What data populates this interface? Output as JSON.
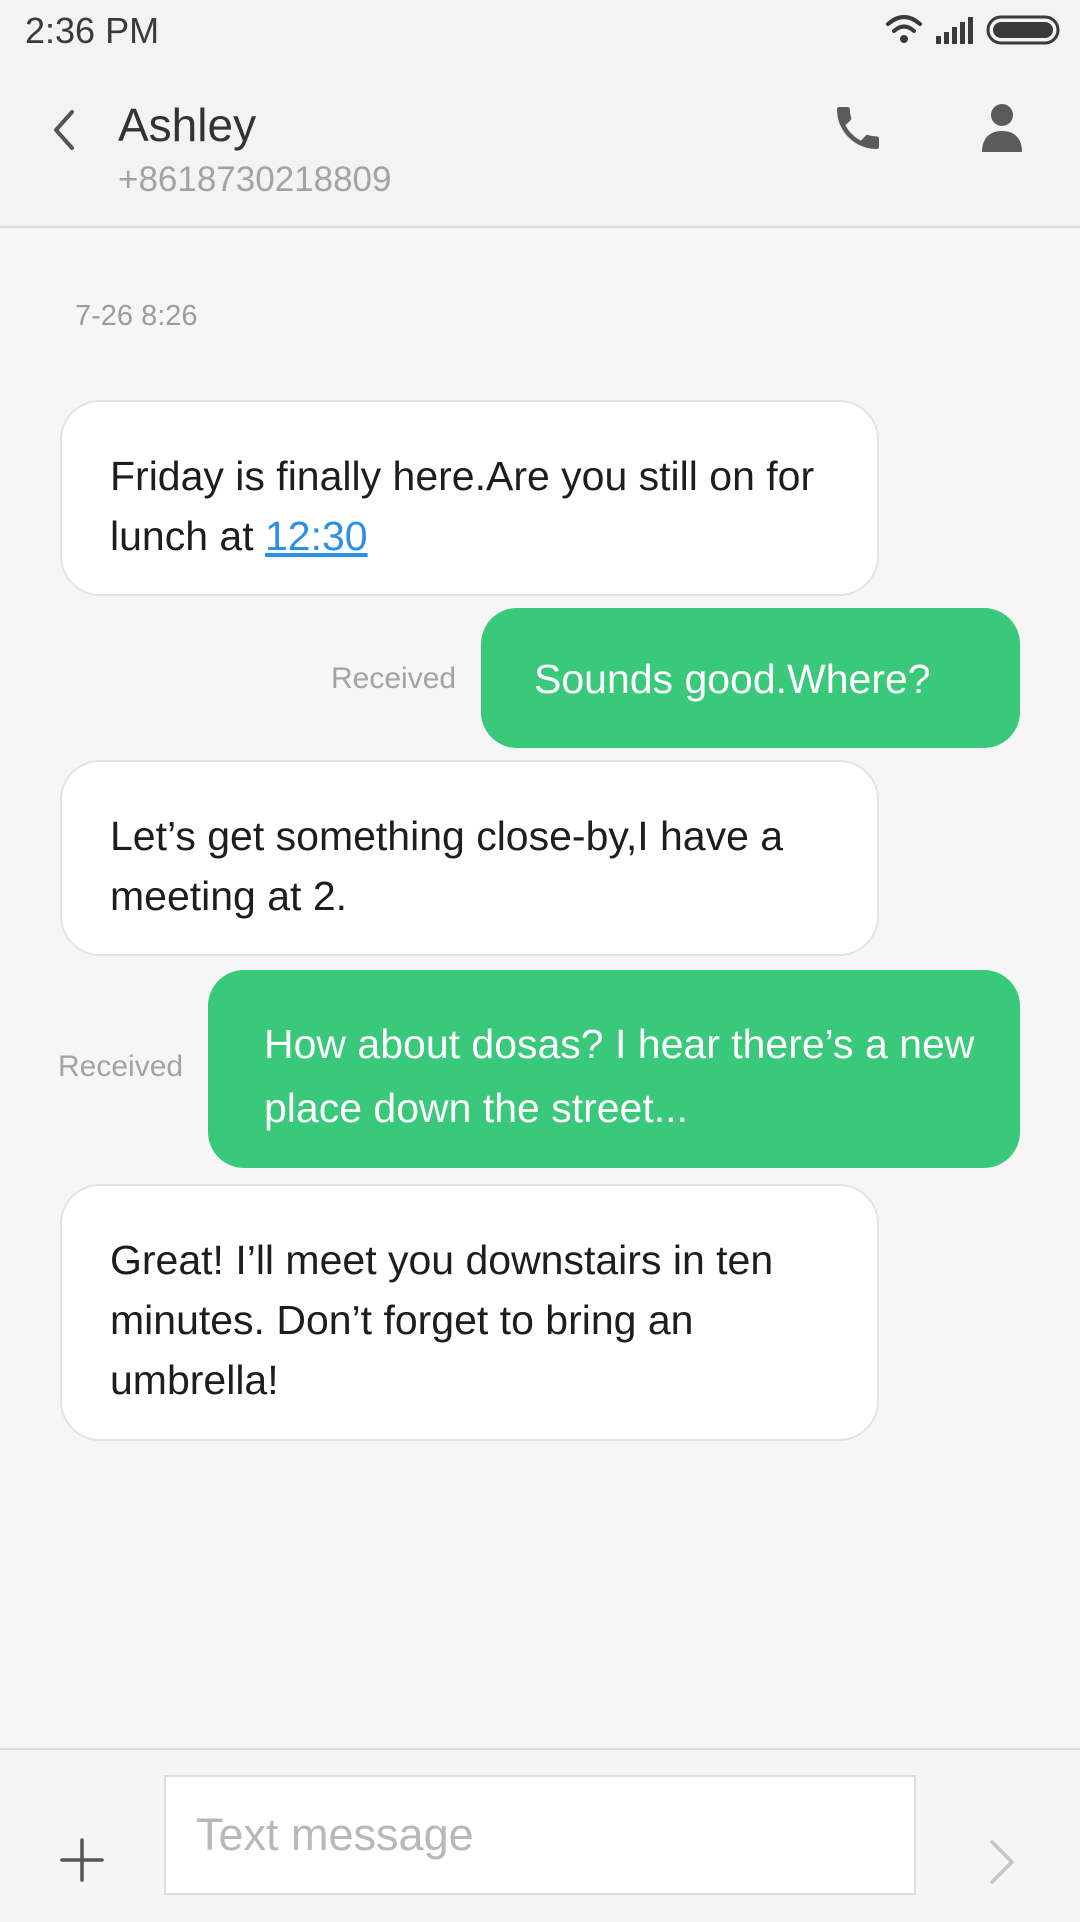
{
  "status_bar": {
    "time": "2:36 PM",
    "icons": [
      "wifi-icon",
      "signal-icon",
      "battery-icon"
    ]
  },
  "header": {
    "contact_name": "Ashley",
    "contact_number": "+8618730218809",
    "icons": [
      "back-icon",
      "phone-icon",
      "contact-icon"
    ]
  },
  "conversation": {
    "timestamp": "7-26 8:26",
    "messages": [
      {
        "direction": "incoming",
        "text": "Friday is finally here.Are you still on for lunch at ",
        "link": "12:30"
      },
      {
        "direction": "outgoing",
        "text": "Sounds good.Where?",
        "status": "Received"
      },
      {
        "direction": "incoming",
        "text": "Let’s get something close-by,I have a meeting at 2."
      },
      {
        "direction": "outgoing",
        "text": "How about dosas? I hear there’s a new place down the street...",
        "status": "Received"
      },
      {
        "direction": "incoming",
        "text": "Great! I’ll meet you downstairs in ten minutes. Don’t forget to bring an umbrella!"
      }
    ]
  },
  "composer": {
    "placeholder": "Text message",
    "value": "",
    "icons": [
      "plus-icon",
      "send-icon"
    ]
  },
  "colors": {
    "outgoing_bubble": "#3ac87a",
    "incoming_bubble": "#ffffff",
    "link": "#2d8fe4",
    "background": "#f5f6f5"
  }
}
